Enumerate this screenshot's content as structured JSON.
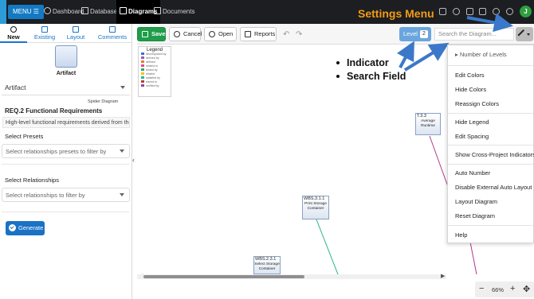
{
  "nav": {
    "menu": "MENU",
    "items": [
      "Dashboard",
      "Database",
      "Diagrams",
      "Documents"
    ],
    "active": "Diagrams",
    "avatar": "J",
    "settings_caption": "Settings Menu"
  },
  "left": {
    "tabs": [
      "New",
      "Existing",
      "Layout",
      "Comments"
    ],
    "diagram_type": "Artifact",
    "artifact_select": "Artifact",
    "diagram_type_small": "Spider Diagram",
    "req_title": "REQ.2 Functional Requirements",
    "req_desc": "High-level functional requirements derived from the l",
    "presets_label": "Select Presets",
    "presets_placeholder": "Select relationships presets to filter by",
    "relationships_label": "Select Relationships",
    "relationships_placeholder": "Select relationships to filter by",
    "generate": "Generate"
  },
  "toolbar": {
    "save": "Save",
    "cancel": "Cancel",
    "open": "Open",
    "reports": "Reports",
    "level_label": "Level",
    "level_value": "2",
    "search_placeholder": "Search the Diagram..."
  },
  "canvas": {
    "legend_title": "Legend",
    "legend_items": [
      {
        "label": "decomposed by",
        "color": "#3a6fd8"
      },
      {
        "label": "derived by",
        "color": "#9b59b6"
      },
      {
        "label": "defined",
        "color": "#e67e22"
      },
      {
        "label": "related to",
        "color": "#e84393"
      },
      {
        "label": "tested by",
        "color": "#27ae60"
      },
      {
        "label": "related",
        "color": "#f1c40f"
      },
      {
        "label": "satisfied by",
        "color": "#1abc9c"
      },
      {
        "label": "traced to",
        "color": "#c0392b"
      },
      {
        "label": "verified by",
        "color": "#8e44ad"
      }
    ],
    "nodes": [
      {
        "id": "T.3.3",
        "name": "Average Runtime"
      },
      {
        "id": "WBS.3.1.1",
        "name": "Print Storage Container"
      },
      {
        "id": "WBS.2.3.1",
        "name": "Select Storage Container"
      }
    ],
    "annotations": [
      "Indicator",
      "Search Field"
    ]
  },
  "settings_menu": {
    "items": [
      "Number of Levels",
      "Edit Colors",
      "Hide Colors",
      "Reassign Colors",
      "Hide Legend",
      "Edit Spacing",
      "Show Cross-Project Indicators",
      "Auto Number",
      "Disable External Auto Layout",
      "Layout Diagram",
      "Reset Diagram",
      "Help"
    ]
  },
  "zoom": {
    "value": "66%"
  },
  "colors": {
    "accent": "#1a73c9",
    "save": "#1f9d4b",
    "level": "#6aa6dd",
    "caption": "#f39c12",
    "arrow": "#3b78c9"
  }
}
